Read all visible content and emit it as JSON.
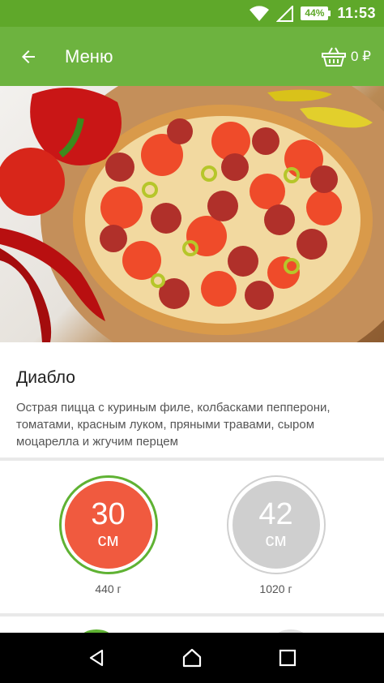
{
  "status_bar": {
    "time": "11:53",
    "battery": "44%",
    "wifi_icon": "wifi-icon",
    "signal_icon": "signal-icon"
  },
  "app_bar": {
    "title": "Меню",
    "back_icon": "arrow-back-icon",
    "cart_icon": "basket-icon",
    "cart_total": "0 ₽"
  },
  "pizza": {
    "name": "Диабло",
    "description": "Острая пицца с куриным филе, колбасками пепперони, томатами, красным луком, пряными травами, сыром моцарелла и жгучим перцем"
  },
  "sizes": [
    {
      "number": "30",
      "unit": "см",
      "weight": "440 г",
      "selected": true,
      "color": "#f05a3f"
    },
    {
      "number": "42",
      "unit": "см",
      "weight": "1020 г",
      "selected": false,
      "color": "#cfcfcf"
    }
  ],
  "nav_bar": {
    "back": "nav-back-icon",
    "home": "nav-home-icon",
    "recents": "nav-recents-icon"
  },
  "colors": {
    "status_bar": "#5fa82a",
    "app_bar": "#6db33f",
    "accent": "#5fb233"
  }
}
